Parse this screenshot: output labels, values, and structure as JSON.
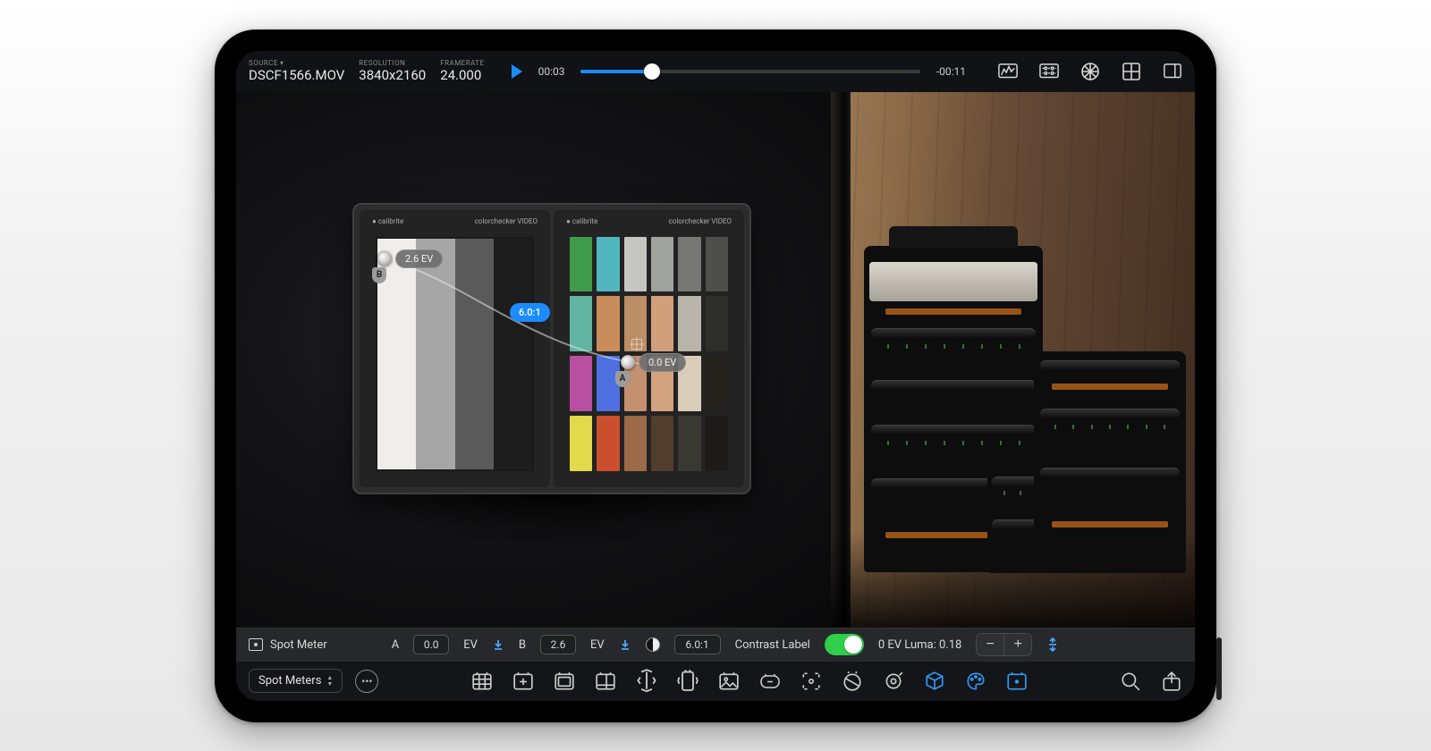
{
  "header": {
    "source_label": "SOURCE",
    "source_value": "DSCF1566.MOV",
    "resolution_label": "RESOLUTION",
    "resolution_value": "3840x2160",
    "framerate_label": "FRAMERATE",
    "framerate_value": "24.000",
    "time_current": "00:03",
    "time_remaining": "-00:11"
  },
  "viewport": {
    "marker_b_letter": "B",
    "marker_b_ev": "2.6 EV",
    "marker_a_letter": "A",
    "marker_a_ev": "0.0 EV",
    "ratio": "6.0:1",
    "cc_brand": "calibrite",
    "cc_product_prefix": "color",
    "cc_product_bold": "checker",
    "cc_product_suffix": " VIDEO"
  },
  "spotbar": {
    "title": "Spot Meter",
    "a_label": "A",
    "a_value": "0.0",
    "ev_label": "EV",
    "b_label": "B",
    "b_value": "2.6",
    "ratio_value": "6.0:1",
    "contrast_label_text": "Contrast Label",
    "luma_text": "0 EV Luma: 0.18"
  },
  "bottom": {
    "mode_select": "Spot Meters"
  },
  "colors": {
    "accent": "#1a8cff",
    "toggle_on": "#2fcf4b"
  },
  "swatches": [
    "#3f9b4a",
    "#52b6bf",
    "#c5c6c1",
    "#a0a29d",
    "#777873",
    "#4e4f4b",
    "#63b5a3",
    "#c98d5c",
    "#bb8e66",
    "#d1a07a",
    "#b9b5ab",
    "#2d2e2a",
    "#b84fa0",
    "#4d6fe0",
    "#c59070",
    "#d2a37e",
    "#dacdb8",
    "#26231f",
    "#e2d94b",
    "#cb4e2e",
    "#9b6a46",
    "#533d2d",
    "#393833",
    "#1c1b19"
  ]
}
